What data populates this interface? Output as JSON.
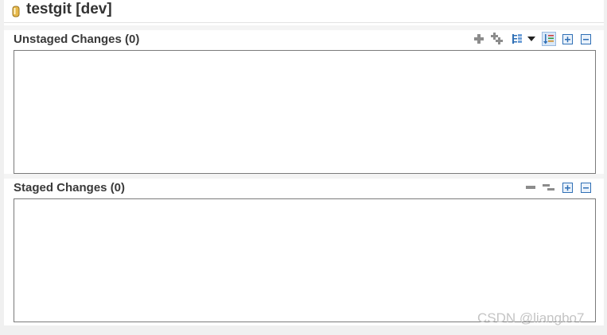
{
  "view": {
    "repository_title": "testgit [dev]"
  },
  "unstaged": {
    "header": "Unstaged Changes (0)",
    "toolbar": [
      "add-icon",
      "add-all-icon",
      "tree-presentation-icon",
      "dropdown-icon",
      "sort-icon",
      "expand-all-icon",
      "collapse-all-icon"
    ]
  },
  "staged": {
    "header": "Staged Changes (0)",
    "toolbar": [
      "remove-icon",
      "remove-all-icon",
      "expand-all-icon",
      "collapse-all-icon"
    ]
  },
  "watermark": "CSDN @liangbo7",
  "colors": {
    "accent": "#2f6fb5",
    "icon_gray": "#8c8c8c",
    "repo_icon": "#e0b040",
    "border": "#7a7a7a"
  }
}
